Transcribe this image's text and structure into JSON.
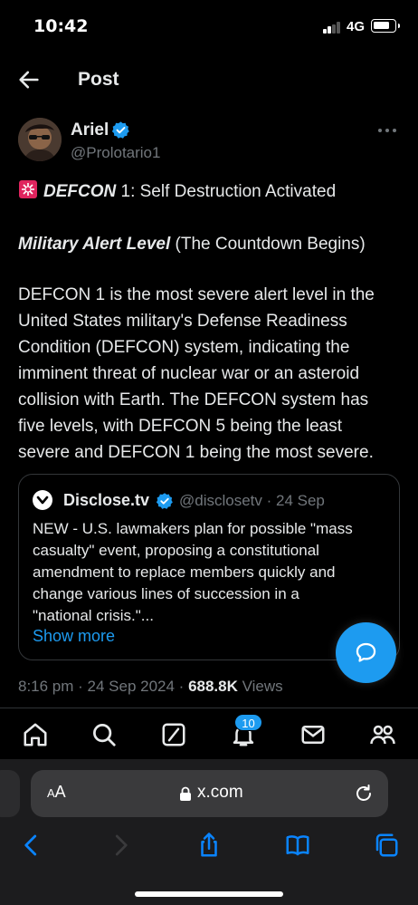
{
  "status_bar": {
    "time": "10:42",
    "network": "4G"
  },
  "header": {
    "title": "Post"
  },
  "author": {
    "name": "Ariel",
    "handle": "@Prolotario1"
  },
  "tweet": {
    "line1_bold": "DEFCON",
    "line1_rest": " 1: Self Destruction Activated",
    "line2_bold": "Military Alert Level",
    "line2_rest": " (The Countdown Begins)",
    "body_lines": [
      "DEFCON 1 is the most severe alert level in the",
      "United States military's Defense Readiness",
      "Condition (DEFCON) system, indicating the",
      "imminent threat of nuclear war or an asteroid",
      "collision with Earth. The DEFCON system has",
      "five levels, with DEFCON 5 being the least",
      "severe and DEFCON 1 being the most severe."
    ]
  },
  "quote": {
    "name": "Disclose.tv",
    "handle_time": "@disclosetv · 24 Sep",
    "lines": [
      "NEW - U.S. lawmakers plan for possible \"mass",
      "casualty\" event, proposing a constitutional",
      "amendment to replace members quickly and",
      "change various lines of succession in a",
      "\"national crisis.\"..."
    ],
    "show_more": "Show more"
  },
  "meta": {
    "time_date": "8:16 pm · 24 Sep 2024 · ",
    "views_count": "688.8K",
    "views_label": " Views"
  },
  "nav": {
    "notifications_badge": "10"
  },
  "safari": {
    "aa_large": "A",
    "aa_small": "A",
    "url": "x.com"
  },
  "colors": {
    "accent": "#1d9bf0",
    "background": "#000000",
    "secondary_text": "#71767b",
    "siren": "#e0245e"
  }
}
